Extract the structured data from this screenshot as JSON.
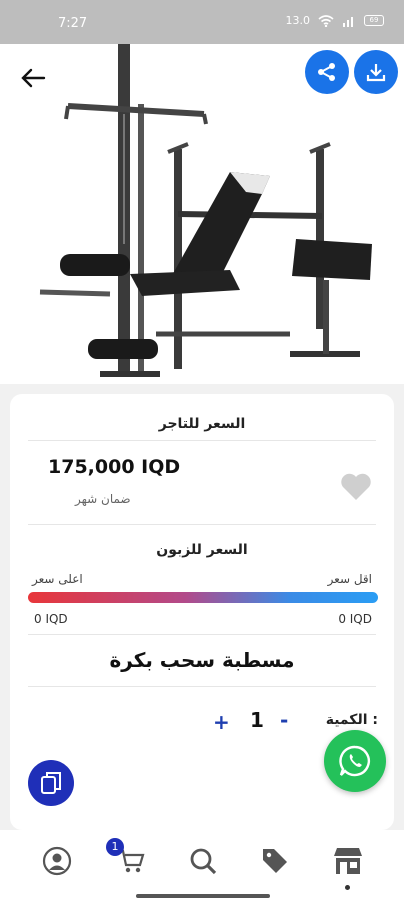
{
  "status_bar": {
    "time": "7:27",
    "network": "13.0",
    "battery": "69"
  },
  "product": {
    "merchant_price_label": "السعر للتاجر",
    "price": "175,000 IQD",
    "guarantee": "ضمان شهر",
    "customer_price_label": "السعر للزبون",
    "lowest_price_label": "اقل سعر",
    "highest_price_label": "اعلى سعر",
    "lowest_price_value": "0 IQD",
    "highest_price_value": "0 IQD",
    "name": "مسطبة سحب بكرة",
    "quantity_label": "الكمية :",
    "quantity": "1",
    "minus": "-",
    "plus": "+"
  },
  "nav": {
    "cart_badge": "1"
  },
  "colors": {
    "accent_blue": "#1a73e8",
    "navy": "#1f2fb8",
    "whatsapp": "#24c15a",
    "gradient_start": "#e8363a",
    "gradient_end": "#2a9df4"
  },
  "icons": [
    "back-arrow-icon",
    "share-icon",
    "download-icon",
    "heart-icon",
    "copy-icon",
    "whatsapp-icon",
    "profile-icon",
    "cart-icon",
    "search-icon",
    "tag-icon",
    "store-icon"
  ]
}
